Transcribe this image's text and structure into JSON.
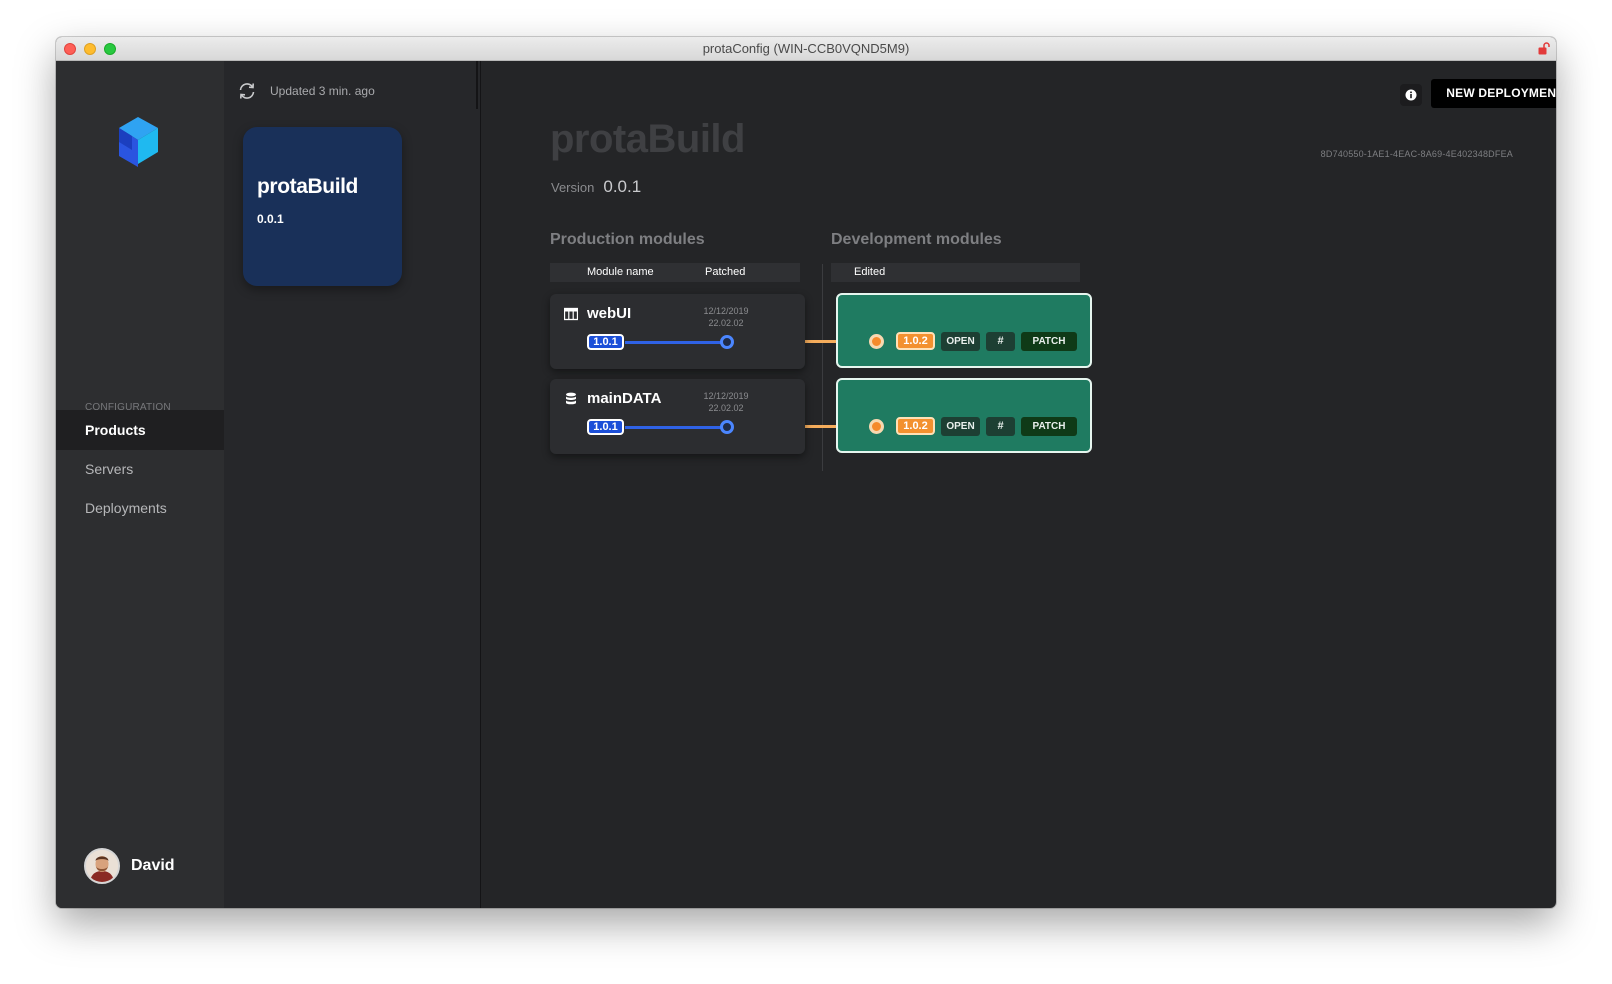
{
  "window": {
    "title": "protaConfig (WIN-CCB0VQND5M9)"
  },
  "sidebar": {
    "section_label": "CONFIGURATION",
    "items": [
      {
        "label": "Products",
        "active": true
      },
      {
        "label": "Servers",
        "active": false
      },
      {
        "label": "Deployments",
        "active": false
      }
    ],
    "user": {
      "name": "David"
    }
  },
  "products_panel": {
    "updated_text": "Updated 3 min. ago",
    "selected_product": {
      "name": "protaBuild",
      "version": "0.0.1"
    }
  },
  "header": {
    "info_icon": "info-icon",
    "new_deployment_label": "NEW DEPLOYMENT"
  },
  "product": {
    "name": "protaBuild",
    "id": "8D740550-1AE1-4EAC-8A69-4E402348DFEA",
    "version_label": "Version",
    "version": "0.0.1"
  },
  "production": {
    "title": "Production modules",
    "columns": {
      "module_name": "Module name",
      "patched": "Patched"
    }
  },
  "development": {
    "title": "Development modules",
    "columns": {
      "edited": "Edited"
    }
  },
  "modules": [
    {
      "name": "webUI",
      "icon": "window-icon",
      "patched_date": "12/12/2019",
      "patched_time": "22.02.02",
      "prod_version": "1.0.1",
      "dev_version": "1.0.2",
      "actions": {
        "open": "OPEN",
        "hash": "#",
        "patch": "PATCH"
      }
    },
    {
      "name": "mainDATA",
      "icon": "database-icon",
      "patched_date": "12/12/2019",
      "patched_time": "22.02.02",
      "prod_version": "1.0.1",
      "dev_version": "1.0.2",
      "actions": {
        "open": "OPEN",
        "hash": "#",
        "patch": "PATCH"
      }
    }
  ],
  "colors": {
    "production_accent": "#2f62e6",
    "development_accent": "#f5ad5c",
    "dev_card": "#1f7b61",
    "product_card": "#193059"
  }
}
